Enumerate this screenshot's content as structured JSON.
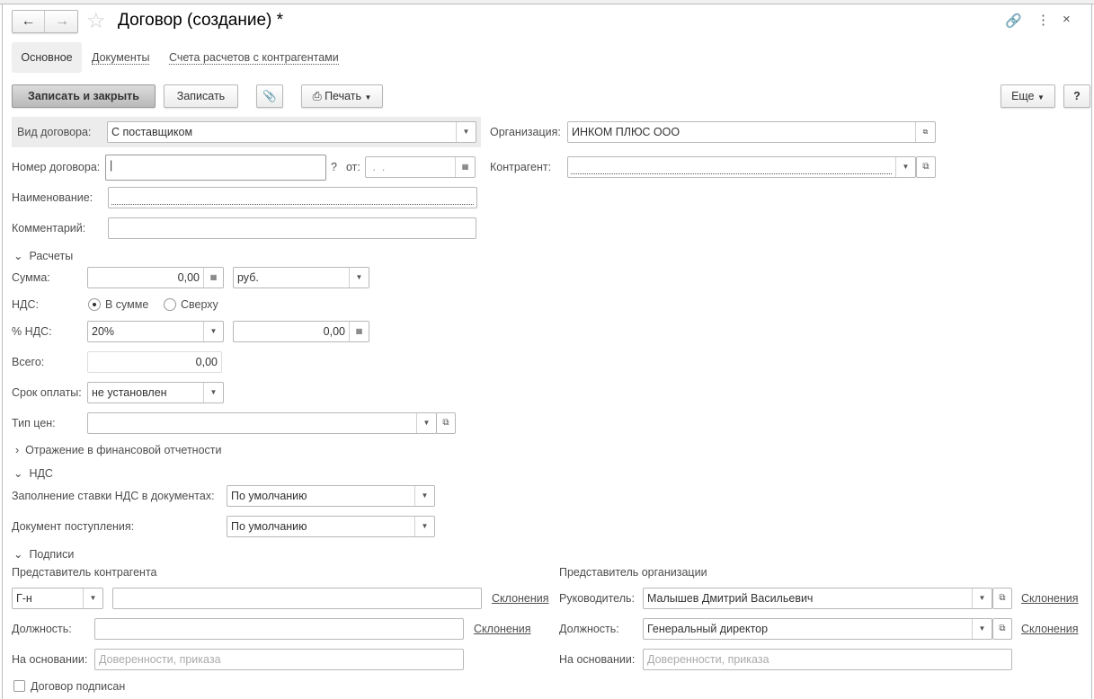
{
  "window": {
    "title": "Договор (создание) *"
  },
  "tabs": [
    "Основное",
    "Документы",
    "Счета расчетов с контрагентами"
  ],
  "toolbar": {
    "save_close": "Записать и закрыть",
    "save": "Записать",
    "print": "Печать",
    "more": "Еще",
    "help": "?"
  },
  "form": {
    "kind_label": "Вид договора:",
    "kind_value": "С поставщиком",
    "org_label": "Организация:",
    "org_value": "ИНКОМ ПЛЮС ООО",
    "number_label": "Номер договора:",
    "number_hint": "?",
    "date_label": "от:",
    "date_value": " .  .  ",
    "counterparty_label": "Контрагент:",
    "counterparty_value": "",
    "name_label": "Наименование:",
    "comment_label": "Комментарий:"
  },
  "calc": {
    "section": "Расчеты",
    "sum_label": "Сумма:",
    "sum_value": "0,00",
    "currency": "руб.",
    "vat_label": "НДС:",
    "vat_in": "В сумме",
    "vat_over": "Сверху",
    "vat_rate_label": "% НДС:",
    "vat_rate": "20%",
    "vat_amount": "0,00",
    "total_label": "Всего:",
    "total_value": "0,00",
    "term_label": "Срок оплаты:",
    "term_value": "не установлен",
    "price_type_label": "Тип цен:",
    "price_type_value": ""
  },
  "fin_section": "Отражение в финансовой отчетности",
  "vat_section": {
    "title": "НДС",
    "fill_label": "Заполнение ставки НДС в документах:",
    "fill_value": "По умолчанию",
    "doc_label": "Документ поступления:",
    "doc_value": "По умолчанию"
  },
  "signs": {
    "title": "Подписи",
    "cp_rep": "Представитель контрагента",
    "org_rep": "Представитель организации",
    "title_value": "Г-н",
    "declension": "Склонения",
    "position_label": "Должность:",
    "basis_label": "На основании:",
    "basis_placeholder": "Доверенности, приказа",
    "head_label": "Руководитель:",
    "head_value": "Малышев Дмитрий Васильевич",
    "head_position": "Генеральный директор",
    "signed": "Договор подписан"
  }
}
